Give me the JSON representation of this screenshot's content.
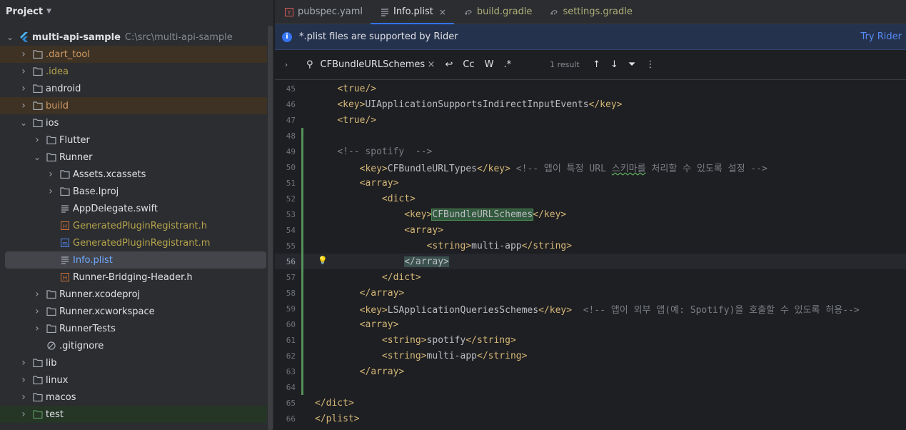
{
  "project_panel": {
    "title": "Project",
    "tree": [
      {
        "label": "multi-api-sample",
        "path": "C:\\src\\multi-api-sample",
        "depth": 0,
        "expanded": true,
        "icon": "flutter-icon",
        "style": "bold"
      },
      {
        "label": ".dart_tool",
        "depth": 1,
        "expanded": false,
        "icon": "folder-icon",
        "style": "orange",
        "bg": "orange"
      },
      {
        "label": ".idea",
        "depth": 1,
        "expanded": false,
        "icon": "folder-icon",
        "style": "olive"
      },
      {
        "label": "android",
        "depth": 1,
        "expanded": false,
        "icon": "folder-icon",
        "style": "normal"
      },
      {
        "label": "build",
        "depth": 1,
        "expanded": false,
        "icon": "folder-icon",
        "style": "orange",
        "bg": "orange"
      },
      {
        "label": "ios",
        "depth": 1,
        "expanded": true,
        "icon": "folder-icon",
        "style": "normal"
      },
      {
        "label": "Flutter",
        "depth": 2,
        "expanded": false,
        "icon": "folder-icon",
        "style": "normal"
      },
      {
        "label": "Runner",
        "depth": 2,
        "expanded": true,
        "icon": "folder-icon",
        "style": "normal"
      },
      {
        "label": "Assets.xcassets",
        "depth": 3,
        "expanded": false,
        "icon": "folder-icon",
        "style": "normal"
      },
      {
        "label": "Base.lproj",
        "depth": 3,
        "expanded": false,
        "icon": "folder-icon",
        "style": "normal"
      },
      {
        "label": "AppDelegate.swift",
        "depth": 3,
        "leaf": true,
        "icon": "text-file-icon",
        "style": "normal"
      },
      {
        "label": "GeneratedPluginRegistrant.h",
        "depth": 3,
        "leaf": true,
        "icon": "header-file-icon",
        "style": "olive"
      },
      {
        "label": "GeneratedPluginRegistrant.m",
        "depth": 3,
        "leaf": true,
        "icon": "m-file-icon",
        "style": "olive"
      },
      {
        "label": "Info.plist",
        "depth": 3,
        "leaf": true,
        "icon": "text-file-icon",
        "style": "blue",
        "selected": true
      },
      {
        "label": "Runner-Bridging-Header.h",
        "depth": 3,
        "leaf": true,
        "icon": "header-file-icon",
        "style": "normal"
      },
      {
        "label": "Runner.xcodeproj",
        "depth": 2,
        "expanded": false,
        "icon": "folder-icon",
        "style": "normal"
      },
      {
        "label": "Runner.xcworkspace",
        "depth": 2,
        "expanded": false,
        "icon": "folder-icon",
        "style": "normal"
      },
      {
        "label": "RunnerTests",
        "depth": 2,
        "expanded": false,
        "icon": "folder-icon",
        "style": "normal"
      },
      {
        "label": ".gitignore",
        "depth": 2,
        "leaf": true,
        "icon": "ignore-file-icon",
        "style": "normal"
      },
      {
        "label": "lib",
        "depth": 1,
        "expanded": false,
        "icon": "folder-icon",
        "style": "normal"
      },
      {
        "label": "linux",
        "depth": 1,
        "expanded": false,
        "icon": "folder-icon",
        "style": "normal"
      },
      {
        "label": "macos",
        "depth": 1,
        "expanded": false,
        "icon": "folder-icon",
        "style": "normal"
      },
      {
        "label": "test",
        "depth": 1,
        "expanded": false,
        "icon": "test-folder-icon",
        "style": "normal",
        "bg": "green"
      }
    ]
  },
  "tabs": [
    {
      "label": "pubspec.yaml",
      "icon": "yaml-icon",
      "active": false
    },
    {
      "label": "Info.plist",
      "icon": "text-file-icon",
      "active": true,
      "closable": true
    },
    {
      "label": "build.gradle",
      "icon": "gradle-icon",
      "active": false
    },
    {
      "label": "settings.gradle",
      "icon": "gradle-icon",
      "active": false
    }
  ],
  "banner": {
    "message": "*.plist files are supported by Rider",
    "action": "Try Rider"
  },
  "search": {
    "query": "CFBundleURLSchemes",
    "match_case": "Cc",
    "words": "W",
    "regex": ".*",
    "result": "1 result"
  },
  "code": {
    "current_line": "56",
    "lines": [
      {
        "n": "45",
        "text": "    <true/>",
        "mod": false
      },
      {
        "n": "46",
        "text": "    <key>UIApplicationSupportsIndirectInputEvents</key>",
        "mod": false
      },
      {
        "n": "47",
        "text": "    <true/>",
        "mod": false
      },
      {
        "n": "48",
        "text": "",
        "mod": true
      },
      {
        "n": "49",
        "text": "    <!-- spotify  -->",
        "mod": true
      },
      {
        "n": "50",
        "text": "        <key>CFBundleURLTypes</key> <!-- 앱이 특정 URL 스키마를 처리할 수 있도록 설정 -->",
        "mod": true
      },
      {
        "n": "51",
        "text": "        <array>",
        "mod": true
      },
      {
        "n": "52",
        "text": "            <dict>",
        "mod": true
      },
      {
        "n": "53",
        "text": "                <key>CFBundleURLSchemes</key>",
        "mod": true
      },
      {
        "n": "54",
        "text": "                <array>",
        "mod": true
      },
      {
        "n": "55",
        "text": "                    <string>multi-app</string>",
        "mod": true
      },
      {
        "n": "56",
        "text": "                </array>",
        "mod": true
      },
      {
        "n": "57",
        "text": "            </dict>",
        "mod": true
      },
      {
        "n": "58",
        "text": "        </array>",
        "mod": true
      },
      {
        "n": "59",
        "text": "        <key>LSApplicationQueriesSchemes</key>  <!-- 앱이 외부 앱(예: Spotify)을 호출할 수 있도록 허용-->",
        "mod": true
      },
      {
        "n": "60",
        "text": "        <array>",
        "mod": true
      },
      {
        "n": "61",
        "text": "            <string>spotify</string>",
        "mod": true
      },
      {
        "n": "62",
        "text": "            <string>multi-app</string>",
        "mod": true
      },
      {
        "n": "63",
        "text": "        </array>",
        "mod": true
      },
      {
        "n": "64",
        "text": "",
        "mod": true
      },
      {
        "n": "65",
        "text": "</dict>",
        "mod": false
      },
      {
        "n": "66",
        "text": "</plist>",
        "mod": false
      }
    ]
  },
  "colors": {
    "accent": "#3574f0",
    "modified_bar": "#549159",
    "search_match": "#32593d"
  }
}
